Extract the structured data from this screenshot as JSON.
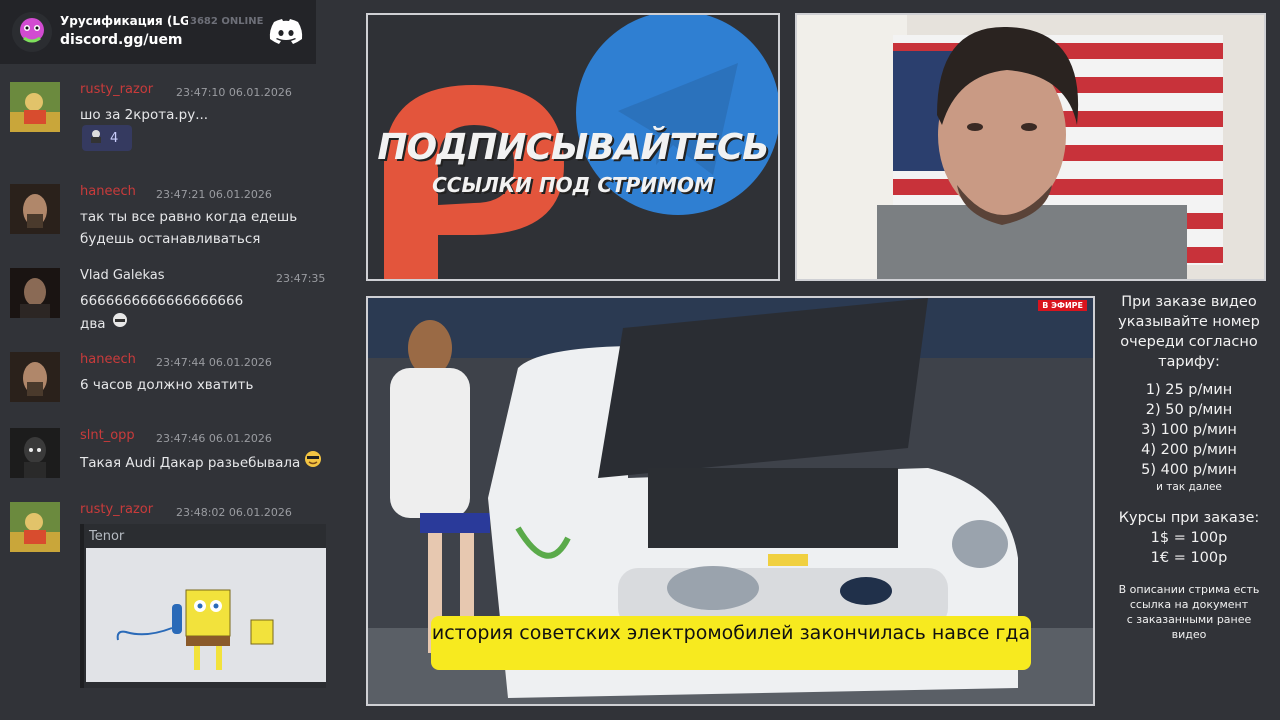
{
  "widget": {
    "guild_name": "Урусификация (LG...",
    "online": "3682 ONLINE",
    "invite": "discord.gg/uem"
  },
  "messages": [
    {
      "author": "rusty_razor",
      "author_color": "#c93b3b",
      "timestamp": "23:47:10 06.01.2026",
      "text": "шо за 2крота.ру...",
      "reaction_count": "4"
    },
    {
      "author": "haneech",
      "author_color": "#c93b3b",
      "timestamp": "23:47:21 06.01.2026",
      "text": "так ты все равно когда едешь будешь останавливаться"
    },
    {
      "author": "Vlad Galekas",
      "author_color": "#e6e7e9",
      "timestamp": "23:47:35",
      "text": "6666666666666666666",
      "text2": "два"
    },
    {
      "author": "haneech",
      "author_color": "#c93b3b",
      "timestamp": "23:47:44 06.01.2026",
      "text": "6 часов должно хватить"
    },
    {
      "author": "slnt_opp",
      "author_color": "#c93b3b",
      "timestamp": "23:47:46 06.01.2026",
      "text": "Такая Audi Дакар разьебывала"
    },
    {
      "author": "rusty_razor",
      "author_color": "#c93b3b",
      "timestamp": "23:48:02 06.01.2026",
      "embed_provider": "Tenor"
    }
  ],
  "promo": {
    "title": "ПОДПИСЫВАЙТЕСЬ",
    "subtitle": "ССЫЛКИ ПОД СТРИМОМ"
  },
  "video": {
    "live_badge": "В ЭФИРЕ",
    "subtitle": "история советских электромобилей закончилась навсе гда"
  },
  "pricing": {
    "intro": [
      "При заказе видео",
      "указывайте номер",
      "очереди согласно",
      "тарифу:"
    ],
    "tiers": [
      "1) 25 р/мин",
      "2) 50 р/мин",
      "3) 100 р/мин",
      "4) 200 р/мин",
      "5) 400 р/мин"
    ],
    "etc": "и так далее",
    "rates_title": "Курсы при заказе:",
    "rates": [
      "1$ = 100р",
      "1€ = 100р"
    ],
    "note": [
      "В описании стрима есть",
      "ссылка на документ",
      "с заказанными ранее",
      "видео"
    ]
  },
  "colors": {
    "background": "#313338",
    "subtitle_box": "#f7ea1f",
    "live_badge": "#d9141e",
    "discord_blurple": "#5865f2",
    "patreon_orange": "#e3553c",
    "telegram_blue": "#2f7fd2"
  }
}
